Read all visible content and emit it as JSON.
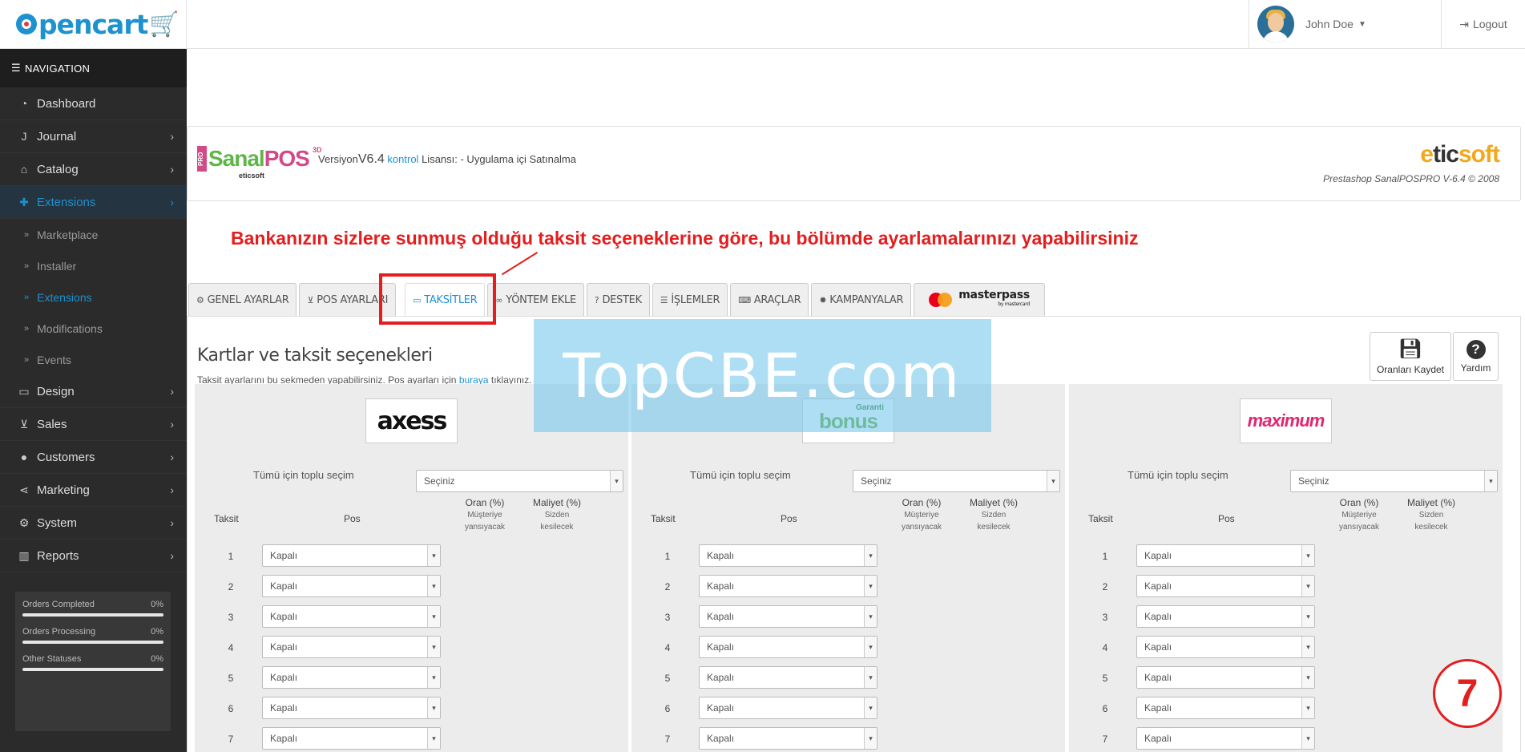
{
  "header": {
    "logo_text": "pencart",
    "logo_cart": "🛒",
    "user_name": "John Doe",
    "logout_label": "Logout"
  },
  "sidebar": {
    "nav_title": "NAVIGATION",
    "items": [
      {
        "label": "Dashboard",
        "icon": "dashboard-icon"
      },
      {
        "label": "Journal",
        "icon": "journal-icon"
      },
      {
        "label": "Catalog",
        "icon": "tag-icon"
      },
      {
        "label": "Extensions",
        "icon": "puzzle-icon"
      },
      {
        "label": "Design",
        "icon": "monitor-icon"
      },
      {
        "label": "Sales",
        "icon": "cart-icon"
      },
      {
        "label": "Customers",
        "icon": "user-icon"
      },
      {
        "label": "Marketing",
        "icon": "share-icon"
      },
      {
        "label": "System",
        "icon": "gear-icon"
      },
      {
        "label": "Reports",
        "icon": "bar-chart-icon"
      }
    ],
    "subitems": [
      "Marketplace",
      "Installer",
      "Extensions",
      "Modifications",
      "Events"
    ],
    "stats": [
      {
        "label": "Orders Completed",
        "value": "0%"
      },
      {
        "label": "Orders Processing",
        "value": "0%"
      },
      {
        "label": "Other Statuses",
        "value": "0%"
      }
    ]
  },
  "module": {
    "brand_pro": "PRO",
    "brand_sanal": "Sanal",
    "brand_pos": "POS",
    "brand_3d": "3D",
    "brand_sub": "eticsoft",
    "version_prefix": "Versiyon",
    "version": "V6.4",
    "control_link": "kontrol",
    "license_text": "Lisansı: - Uygulama içi Satınalma",
    "vendor_e": "e",
    "vendor_tic": "tic",
    "vendor_soft": "soft",
    "vendor_caption": "Prestashop SanalPOSPRO V-6.4 © 2008"
  },
  "annotation": "Bankanızın sizlere sunmuş olduğu taksit seçeneklerine göre, bu bölümde ayarlamalarınızı yapabilirsiniz",
  "tabs": [
    {
      "label": "GENEL AYARLAR",
      "icon": "gears-icon"
    },
    {
      "label": "POS AYARLARI",
      "icon": "cart-icon"
    },
    {
      "label": "TAKSİTLER",
      "icon": "credit-card-icon"
    },
    {
      "label": "YÖNTEM EKLE",
      "icon": "link-icon"
    },
    {
      "label": "DESTEK",
      "icon": "question-icon"
    },
    {
      "label": "İŞLEMLER",
      "icon": "list-icon"
    },
    {
      "label": "ARAÇLAR",
      "icon": "keyboard-icon"
    },
    {
      "label": "KAMPANYALAR",
      "icon": "badge-icon"
    }
  ],
  "masterpass": {
    "label": "masterpass",
    "sub": "by mastercard"
  },
  "panel": {
    "title": "Kartlar ve taksit seçenekleri",
    "desc_prefix": "Taksit ayarlarını bu sekmeden yapabilirsiniz. Pos ayarları için",
    "desc_link": "buraya",
    "desc_suffix": "tıklayınız.",
    "save_label": "Oranları Kaydet",
    "help_label": "Yardım"
  },
  "banks": [
    {
      "logo": "axess",
      "logo_sub": ""
    },
    {
      "logo": "bonus",
      "logo_sub": "Garanti"
    },
    {
      "logo": "maximum",
      "logo_sub": ""
    }
  ],
  "table": {
    "bulk_label": "Tümü için toplu seçim",
    "bulk_value": "Seçiniz",
    "h_taksit": "Taksit",
    "h_pos": "Pos",
    "h_oran": "Oran (%)",
    "h_oran_sub1": "Müşteriye",
    "h_oran_sub2": "yansıyacak",
    "h_maliyet": "Maliyet (%)",
    "h_maliyet_sub1": "Sizden",
    "h_maliyet_sub2": "kesilecek",
    "rows": [
      "1",
      "2",
      "3",
      "4",
      "5",
      "6",
      "7"
    ],
    "row_value": "Kapalı"
  },
  "watermark": "TopCBE.com",
  "step": "7",
  "colors": {
    "accent": "#1e91cf",
    "annotation": "#e31e1e",
    "sidebar": "#2b2b2b"
  }
}
